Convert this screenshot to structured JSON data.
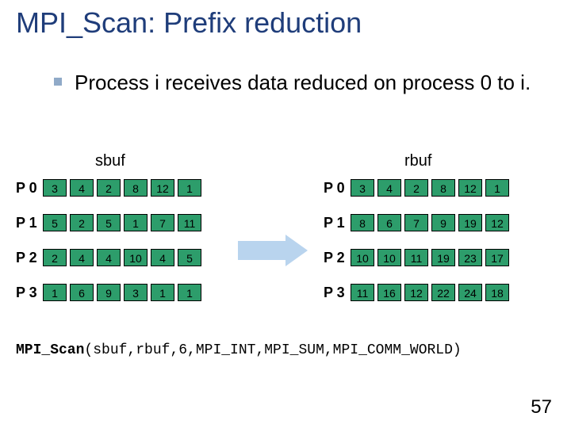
{
  "title": "MPI_Scan: Prefix reduction",
  "bullet": "Process i receives data reduced on process 0 to i.",
  "labels": {
    "sbuf": "sbuf",
    "rbuf": "rbuf"
  },
  "sbuf_rows": [
    {
      "proc": "P 0",
      "cells": [
        "3",
        "4",
        "2",
        "8",
        "12",
        "1"
      ]
    },
    {
      "proc": "P 1",
      "cells": [
        "5",
        "2",
        "5",
        "1",
        "7",
        "11"
      ]
    },
    {
      "proc": "P 2",
      "cells": [
        "2",
        "4",
        "4",
        "10",
        "4",
        "5"
      ]
    },
    {
      "proc": "P 3",
      "cells": [
        "1",
        "6",
        "9",
        "3",
        "1",
        "1"
      ]
    }
  ],
  "rbuf_rows": [
    {
      "proc": "P 0",
      "cells": [
        "3",
        "4",
        "2",
        "8",
        "12",
        "1"
      ]
    },
    {
      "proc": "P 1",
      "cells": [
        "8",
        "6",
        "7",
        "9",
        "19",
        "12"
      ]
    },
    {
      "proc": "P 2",
      "cells": [
        "10",
        "10",
        "11",
        "19",
        "23",
        "17"
      ]
    },
    {
      "proc": "P 3",
      "cells": [
        "11",
        "16",
        "12",
        "22",
        "24",
        "18"
      ]
    }
  ],
  "code": {
    "fn": "MPI_Scan",
    "args": "(sbuf,rbuf,6,MPI_INT,MPI_SUM,MPI_COMM_WORLD)"
  },
  "page": "57",
  "chart_data": {
    "type": "table",
    "title": "MPI_Scan prefix-sum over 4 processes, 6 ints, MPI_SUM",
    "series": [
      {
        "name": "sbuf P0",
        "values": [
          3,
          4,
          2,
          8,
          12,
          1
        ]
      },
      {
        "name": "sbuf P1",
        "values": [
          5,
          2,
          5,
          1,
          7,
          11
        ]
      },
      {
        "name": "sbuf P2",
        "values": [
          2,
          4,
          4,
          10,
          4,
          5
        ]
      },
      {
        "name": "sbuf P3",
        "values": [
          1,
          6,
          9,
          3,
          1,
          1
        ]
      },
      {
        "name": "rbuf P0",
        "values": [
          3,
          4,
          2,
          8,
          12,
          1
        ]
      },
      {
        "name": "rbuf P1",
        "values": [
          8,
          6,
          7,
          9,
          19,
          12
        ]
      },
      {
        "name": "rbuf P2",
        "values": [
          10,
          10,
          11,
          19,
          23,
          17
        ]
      },
      {
        "name": "rbuf P3",
        "values": [
          11,
          16,
          12,
          22,
          24,
          18
        ]
      }
    ]
  }
}
